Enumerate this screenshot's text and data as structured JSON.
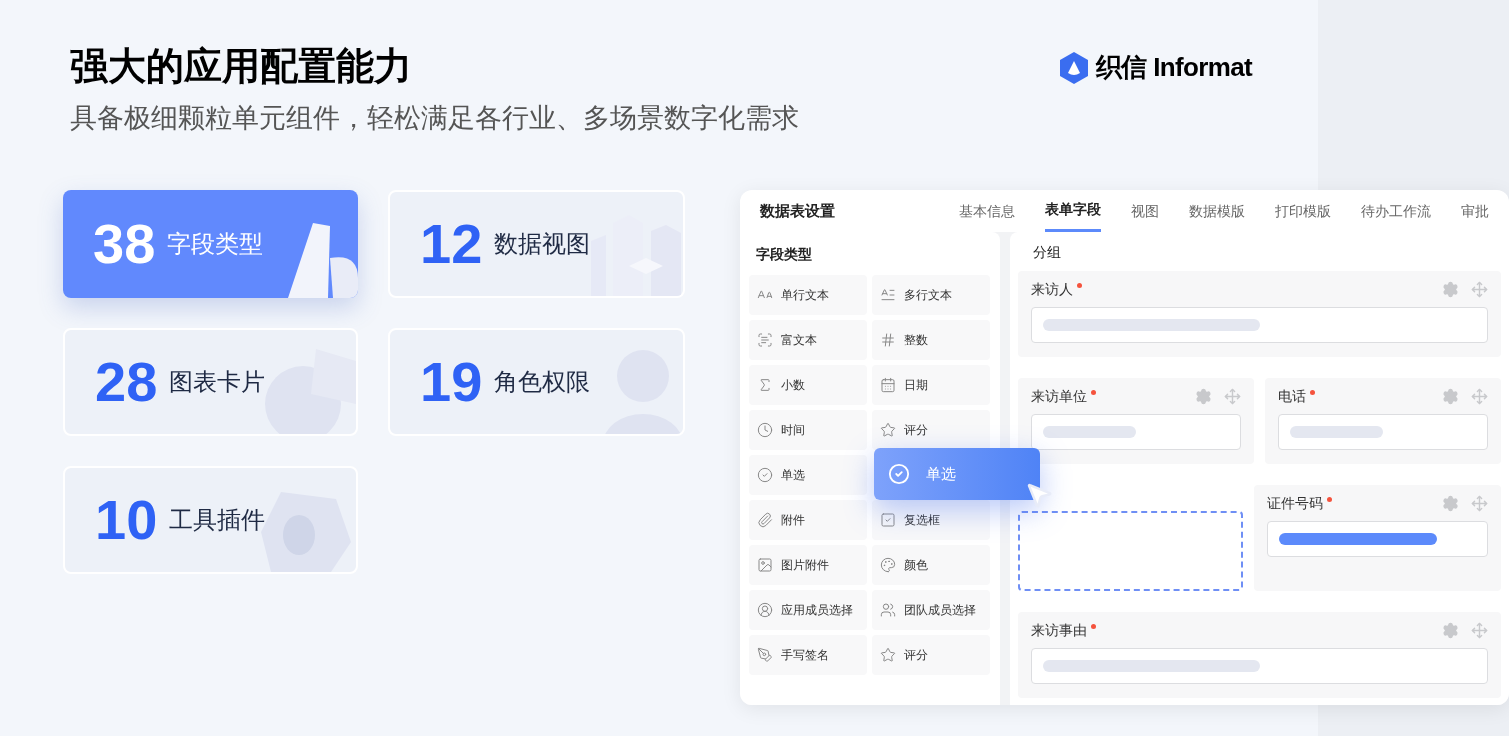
{
  "header": {
    "title": "强大的应用配置能力",
    "subtitle": "具备极细颗粒单元组件，轻松满足各行业、多场景数字化需求",
    "logo_text": "织信 Informat"
  },
  "stat_cards": [
    {
      "number": "38",
      "label": "字段类型",
      "selected": true,
      "kind": "letters"
    },
    {
      "number": "12",
      "label": "数据视图",
      "selected": false,
      "kind": "cubes"
    },
    {
      "number": "28",
      "label": "图表卡片",
      "selected": false,
      "kind": "pie"
    },
    {
      "number": "19",
      "label": "角色权限",
      "selected": false,
      "kind": "person"
    },
    {
      "number": "10",
      "label": "工具插件",
      "selected": false,
      "kind": "nut"
    }
  ],
  "panel": {
    "title": "数据表设置",
    "tabs": [
      {
        "label": "基本信息",
        "selected": false
      },
      {
        "label": "表单字段",
        "selected": true
      },
      {
        "label": "视图",
        "selected": false
      },
      {
        "label": "数据模版",
        "selected": false
      },
      {
        "label": "打印模版",
        "selected": false
      },
      {
        "label": "待办工作流",
        "selected": false
      },
      {
        "label": "审批",
        "selected": false
      }
    ],
    "field_types": {
      "heading": "字段类型",
      "items": [
        "单行文本",
        "多行文本",
        "富文本",
        "整数",
        "小数",
        "日期",
        "时间",
        "评分",
        "单选",
        "附件",
        "复选框",
        "图片附件",
        "颜色",
        "应用成员选择",
        "团队成员选择",
        "手写签名",
        "评分"
      ]
    },
    "dragged_item": {
      "label": "单选"
    },
    "form": {
      "heading": "分组",
      "rows": [
        [
          {
            "kind": "field",
            "label": "来访人",
            "required": true,
            "highlighted": false
          }
        ],
        [
          {
            "kind": "field",
            "label": "来访单位",
            "required": true,
            "highlighted": false
          },
          {
            "kind": "field",
            "label": "电话",
            "required": true,
            "highlighted": false
          }
        ],
        [
          {
            "kind": "dropzone"
          },
          {
            "kind": "field",
            "label": "证件号码",
            "required": true,
            "highlighted": true
          }
        ],
        [
          {
            "kind": "field",
            "label": "来访事由",
            "required": true,
            "highlighted": false
          }
        ]
      ]
    }
  }
}
